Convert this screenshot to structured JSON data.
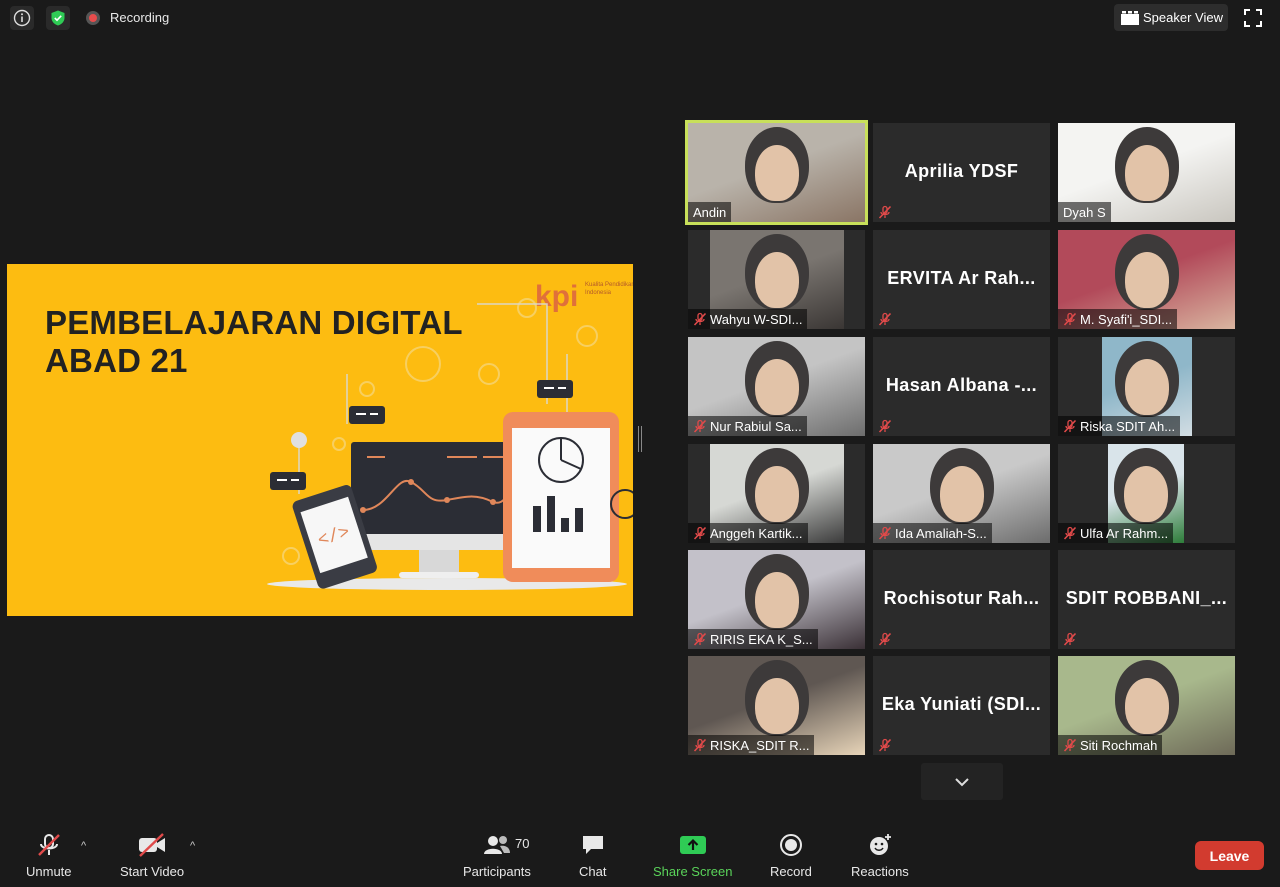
{
  "top": {
    "recording_label": "Recording",
    "speaker_view_label": "Speaker View"
  },
  "slide": {
    "title_line1": "PEMBELAJARAN DIGITAL",
    "title_line2": "ABAD 21",
    "logo_text": "kpi",
    "tagline": "Kualita Pendidikan Indonesia"
  },
  "gallery": [
    {
      "name": "Andin",
      "video": true,
      "muted": false,
      "active": true
    },
    {
      "name": "Aprilia YDSF",
      "video": false,
      "muted": true
    },
    {
      "name": "Dyah S",
      "video": true,
      "muted": false
    },
    {
      "name": "Wahyu W-SDI...",
      "video": true,
      "muted": true
    },
    {
      "name": "ERVITA Ar Rah...",
      "video": false,
      "muted": true
    },
    {
      "name": "M. Syafi'i_SDI...",
      "video": true,
      "muted": true
    },
    {
      "name": "Nur Rabiul Sa...",
      "video": true,
      "muted": true
    },
    {
      "name": "Hasan Albana -...",
      "video": false,
      "muted": true
    },
    {
      "name": "Riska SDIT Ah...",
      "video": true,
      "muted": true
    },
    {
      "name": "Anggeh Kartik...",
      "video": true,
      "muted": true
    },
    {
      "name": "Ida Amaliah-S...",
      "video": true,
      "muted": true
    },
    {
      "name": "Ulfa Ar Rahm...",
      "video": true,
      "muted": true
    },
    {
      "name": "RIRIS EKA K_S...",
      "video": true,
      "muted": true
    },
    {
      "name": "Rochisotur Rah...",
      "video": false,
      "muted": true
    },
    {
      "name": "SDIT ROBBANI_...",
      "video": false,
      "muted": true
    },
    {
      "name": "RISKA_SDIT R...",
      "video": true,
      "muted": true
    },
    {
      "name": "Eka Yuniati (SDI...",
      "video": false,
      "muted": true
    },
    {
      "name": "Siti Rochmah",
      "video": true,
      "muted": true
    }
  ],
  "toolbar": {
    "unmute": "Unmute",
    "start_video": "Start Video",
    "participants": "Participants",
    "participants_count": "70",
    "chat": "Chat",
    "share_screen": "Share Screen",
    "record": "Record",
    "reactions": "Reactions",
    "leave": "Leave"
  },
  "colors": {
    "slide_bg": "#fdbc11",
    "active_speaker": "#c8e05a",
    "share_green": "#5ad35a",
    "leave_red": "#d23b2f",
    "mute_red": "#e04a4a"
  }
}
